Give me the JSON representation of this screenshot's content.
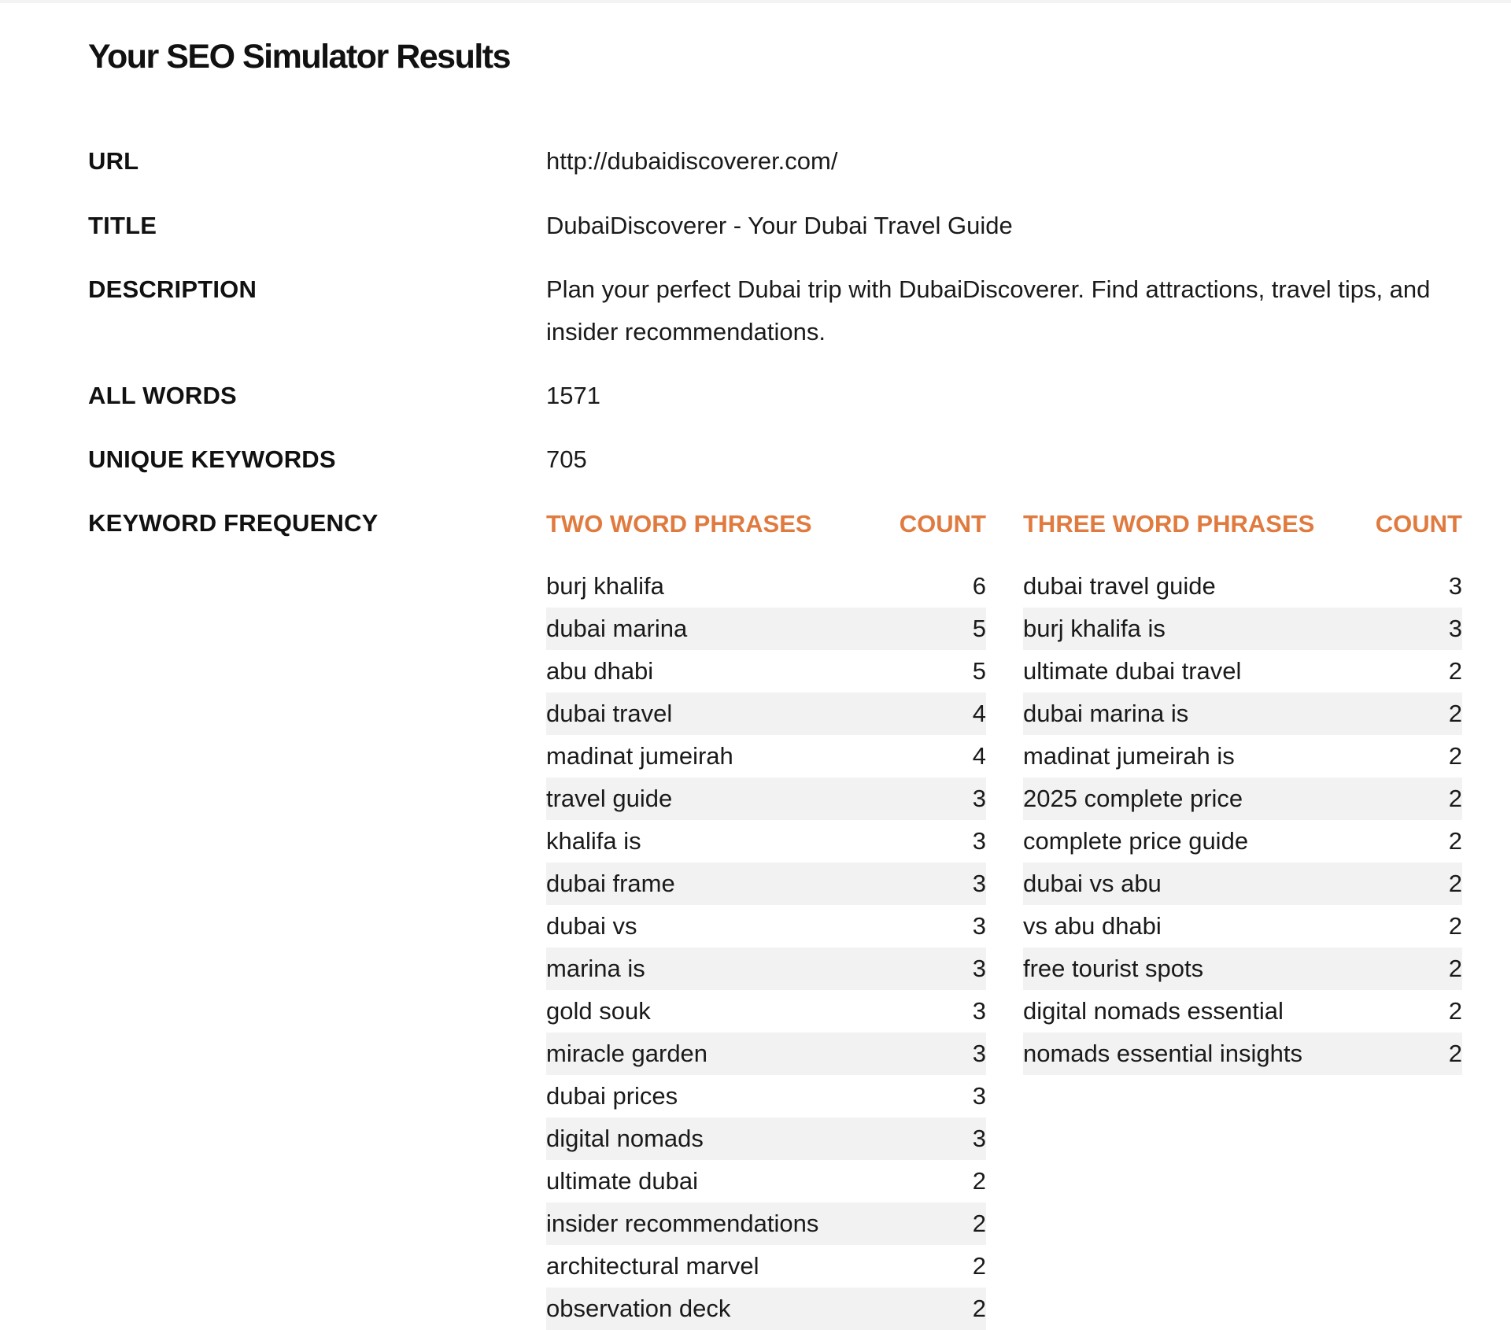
{
  "page_title": "Your SEO Simulator Results",
  "fields": {
    "url": {
      "label": "URL",
      "value": "http://dubaidiscoverer.com/"
    },
    "title": {
      "label": "TITLE",
      "value": "DubaiDiscoverer - Your Dubai Travel Guide"
    },
    "description": {
      "label": "DESCRIPTION",
      "value": "Plan your perfect Dubai trip with DubaiDiscoverer. Find attractions, travel tips, and insider recommendations."
    },
    "all_words": {
      "label": "ALL WORDS",
      "value": "1571"
    },
    "unique_keywords": {
      "label": "UNIQUE KEYWORDS",
      "value": "705"
    },
    "keyword_frequency": {
      "label": "KEYWORD FREQUENCY"
    }
  },
  "two_word": {
    "header_phrase": "TWO WORD PHRASES",
    "header_count": "COUNT",
    "rows": [
      {
        "phrase": "burj khalifa",
        "count": "6"
      },
      {
        "phrase": "dubai marina",
        "count": "5"
      },
      {
        "phrase": "abu dhabi",
        "count": "5"
      },
      {
        "phrase": "dubai travel",
        "count": "4"
      },
      {
        "phrase": "madinat jumeirah",
        "count": "4"
      },
      {
        "phrase": "travel guide",
        "count": "3"
      },
      {
        "phrase": "khalifa is",
        "count": "3"
      },
      {
        "phrase": "dubai frame",
        "count": "3"
      },
      {
        "phrase": "dubai vs",
        "count": "3"
      },
      {
        "phrase": "marina is",
        "count": "3"
      },
      {
        "phrase": "gold souk",
        "count": "3"
      },
      {
        "phrase": "miracle garden",
        "count": "3"
      },
      {
        "phrase": "dubai prices",
        "count": "3"
      },
      {
        "phrase": "digital nomads",
        "count": "3"
      },
      {
        "phrase": "ultimate dubai",
        "count": "2"
      },
      {
        "phrase": "insider recommendations",
        "count": "2"
      },
      {
        "phrase": "architectural marvel",
        "count": "2"
      },
      {
        "phrase": "observation deck",
        "count": "2"
      }
    ]
  },
  "three_word": {
    "header_phrase": "THREE WORD PHRASES",
    "header_count": "COUNT",
    "rows": [
      {
        "phrase": "dubai travel guide",
        "count": "3"
      },
      {
        "phrase": "burj khalifa is",
        "count": "3"
      },
      {
        "phrase": "ultimate dubai travel",
        "count": "2"
      },
      {
        "phrase": "dubai marina is",
        "count": "2"
      },
      {
        "phrase": "madinat jumeirah is",
        "count": "2"
      },
      {
        "phrase": "2025 complete price",
        "count": "2"
      },
      {
        "phrase": "complete price guide",
        "count": "2"
      },
      {
        "phrase": "dubai vs abu",
        "count": "2"
      },
      {
        "phrase": "vs abu dhabi",
        "count": "2"
      },
      {
        "phrase": "free tourist spots",
        "count": "2"
      },
      {
        "phrase": "digital nomads essential",
        "count": "2"
      },
      {
        "phrase": "nomads essential insights",
        "count": "2"
      }
    ]
  },
  "colors": {
    "accent": "#e07a3e",
    "stripe": "#f2f2f2",
    "text": "#161616"
  }
}
